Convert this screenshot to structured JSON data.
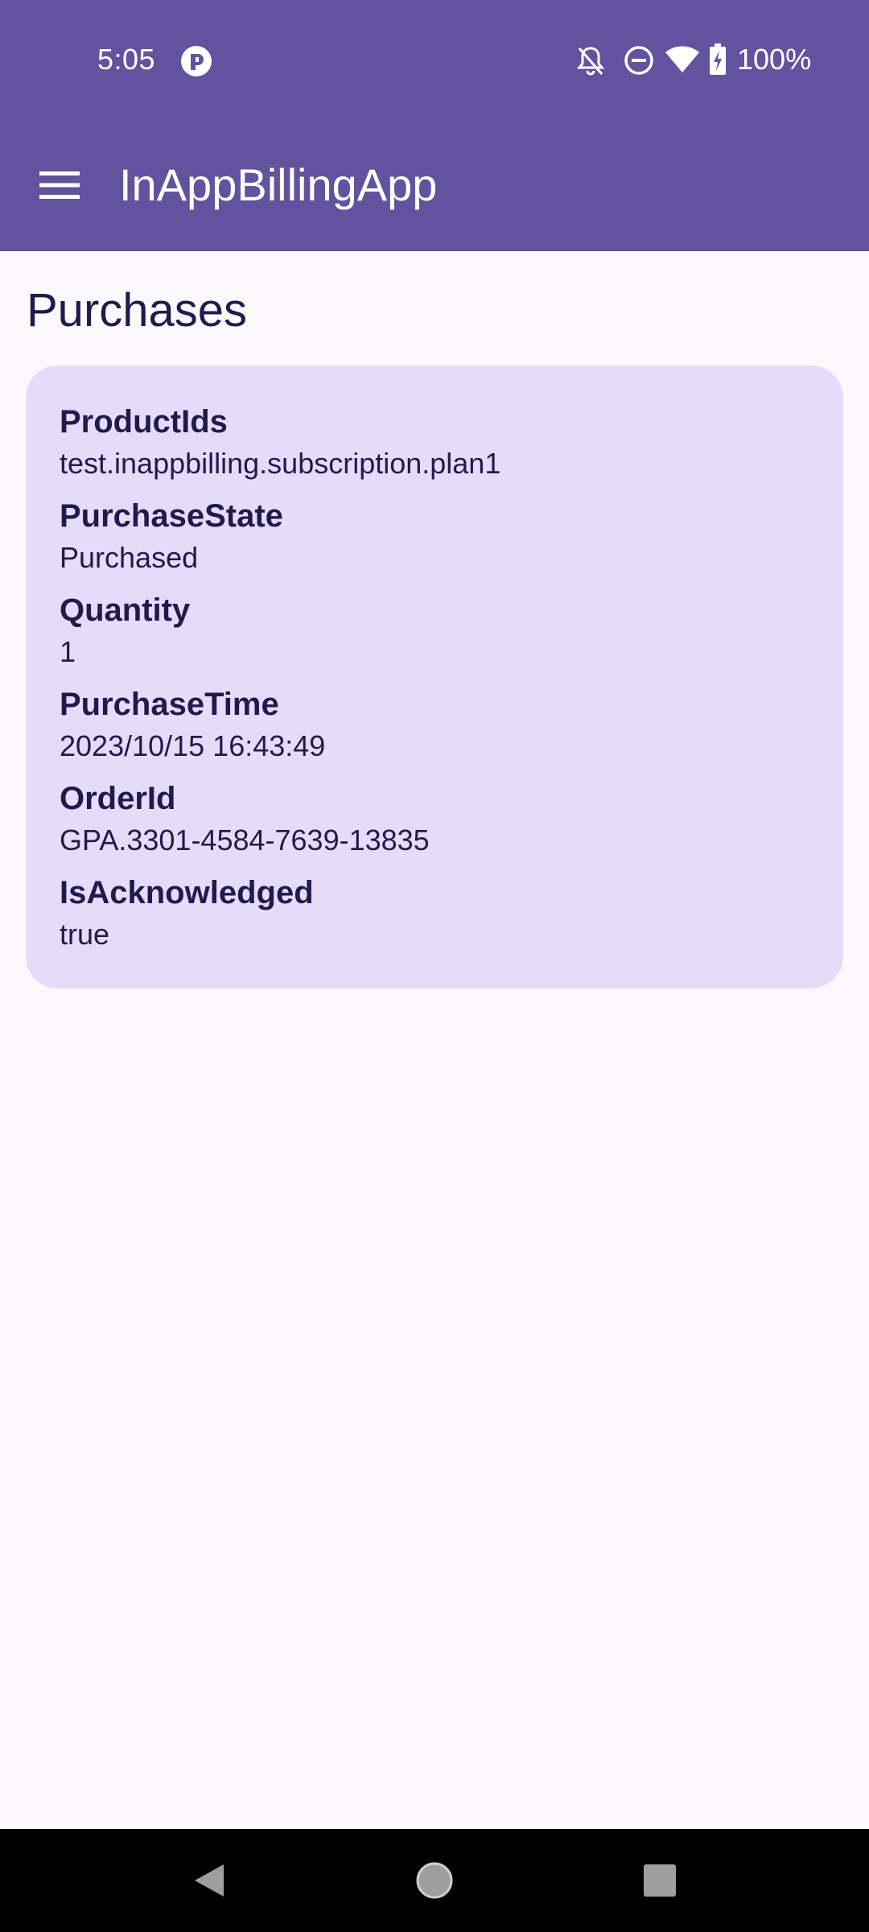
{
  "status_bar": {
    "time": "5:05",
    "battery_percent": "100%",
    "icons": [
      "app-notification-icon",
      "notifications-off-icon",
      "do-not-disturb-icon",
      "wifi-icon",
      "battery-charging-icon"
    ]
  },
  "app_bar": {
    "title": "InAppBillingApp",
    "menu_icon": "menu-icon"
  },
  "page": {
    "title": "Purchases"
  },
  "purchase": {
    "fields": [
      {
        "label": "ProductIds",
        "value": "test.inappbilling.subscription.plan1"
      },
      {
        "label": "PurchaseState",
        "value": "Purchased"
      },
      {
        "label": "Quantity",
        "value": "1"
      },
      {
        "label": "PurchaseTime",
        "value": "2023/10/15 16:43:49"
      },
      {
        "label": "OrderId",
        "value": "GPA.3301-4584-7639-13835"
      },
      {
        "label": "IsAcknowledged",
        "value": "true"
      }
    ]
  },
  "nav_bar": {
    "icons": [
      "back-icon",
      "home-icon",
      "recents-icon"
    ]
  },
  "colors": {
    "primary": "#62539e",
    "card_background": "#e6dcfa",
    "text": "#211a4c",
    "background": "#fcf9fd"
  }
}
